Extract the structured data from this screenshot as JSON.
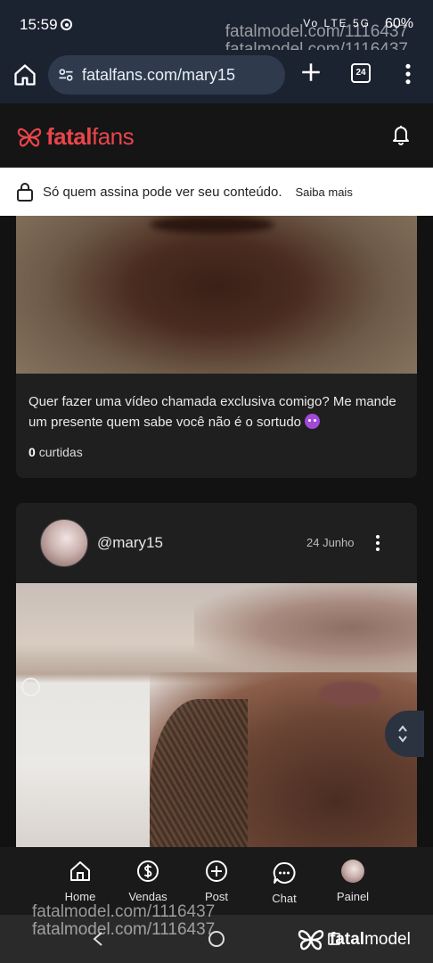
{
  "status": {
    "time": "15:59",
    "signal_text": "Vo LTE 5G",
    "battery": "60%"
  },
  "watermark": {
    "text": "fatalmodel.com/1116437"
  },
  "browser": {
    "url": "fatalfans.com/mary15",
    "tab_count": "24"
  },
  "app": {
    "logo_bold": "fatal",
    "logo_light": "fans",
    "brand_color": "#e8454a"
  },
  "banner": {
    "message": "Só quem assina pode ver seu conteúdo.",
    "link": "Saiba mais"
  },
  "posts": [
    {
      "caption": "Quer fazer uma vídeo chamada exclusiva comigo? Me mande um presente quem sabe você não é o sortudo",
      "likes_count": "0",
      "likes_label": "curtidas"
    },
    {
      "handle": "@mary15",
      "date": "24 Junho"
    }
  ],
  "bottom_nav": [
    {
      "label": "Home",
      "icon": "home-icon"
    },
    {
      "label": "Vendas",
      "icon": "dollar-icon"
    },
    {
      "label": "Post",
      "icon": "plus-circle-icon"
    },
    {
      "label": "Chat",
      "icon": "chat-icon"
    },
    {
      "label": "Painel",
      "icon": "avatar"
    }
  ],
  "footer_logo": {
    "bold": "fatal",
    "light": "model"
  }
}
